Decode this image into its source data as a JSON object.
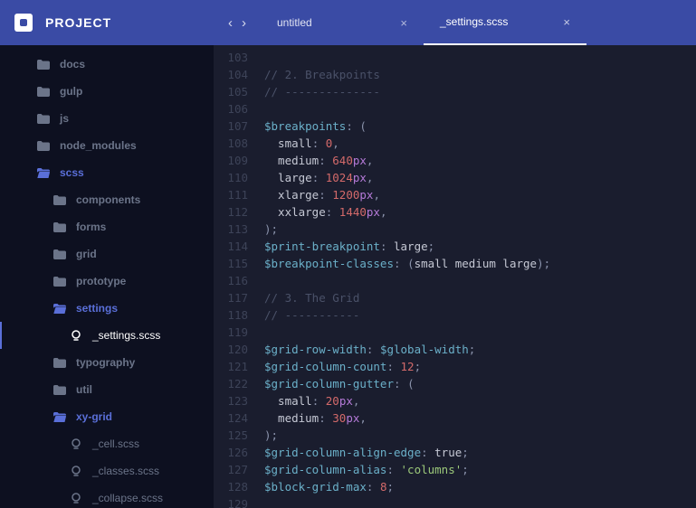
{
  "header": {
    "project_label": "PROJECT"
  },
  "tabs": [
    {
      "label": "untitled",
      "active": false
    },
    {
      "label": "_settings.scss",
      "active": true
    }
  ],
  "tree": [
    {
      "label": "docs",
      "type": "folder",
      "depth": 0,
      "expanded": false
    },
    {
      "label": "gulp",
      "type": "folder",
      "depth": 0,
      "expanded": false
    },
    {
      "label": "js",
      "type": "folder",
      "depth": 0,
      "expanded": false
    },
    {
      "label": "node_modules",
      "type": "folder",
      "depth": 0,
      "expanded": false
    },
    {
      "label": "scss",
      "type": "folder",
      "depth": 0,
      "expanded": true
    },
    {
      "label": "components",
      "type": "folder",
      "depth": 1,
      "expanded": false
    },
    {
      "label": "forms",
      "type": "folder",
      "depth": 1,
      "expanded": false
    },
    {
      "label": "grid",
      "type": "folder",
      "depth": 1,
      "expanded": false
    },
    {
      "label": "prototype",
      "type": "folder",
      "depth": 1,
      "expanded": false
    },
    {
      "label": "settings",
      "type": "folder",
      "depth": 1,
      "expanded": true
    },
    {
      "label": "_settings.scss",
      "type": "file",
      "depth": 2,
      "active": true
    },
    {
      "label": "typography",
      "type": "folder",
      "depth": 1,
      "expanded": false
    },
    {
      "label": "util",
      "type": "folder",
      "depth": 1,
      "expanded": false
    },
    {
      "label": "xy-grid",
      "type": "folder",
      "depth": 1,
      "expanded": true
    },
    {
      "label": "_cell.scss",
      "type": "file",
      "depth": 2,
      "active": false
    },
    {
      "label": "_classes.scss",
      "type": "file",
      "depth": 2,
      "active": false
    },
    {
      "label": "_collapse.scss",
      "type": "file",
      "depth": 2,
      "active": false
    }
  ],
  "editor": {
    "first_line_number": 103,
    "lines": [
      [],
      [
        {
          "t": "// 2. Breakpoints",
          "c": "comment"
        }
      ],
      [
        {
          "t": "// --------------",
          "c": "comment"
        }
      ],
      [],
      [
        {
          "t": "$breakpoints",
          "c": "var"
        },
        {
          "t": ":",
          "c": "punc"
        },
        {
          "t": " ",
          "c": "kw"
        },
        {
          "t": "(",
          "c": "punc"
        }
      ],
      [
        {
          "t": "  small",
          "c": "kw"
        },
        {
          "t": ":",
          "c": "punc"
        },
        {
          "t": " ",
          "c": "kw"
        },
        {
          "t": "0",
          "c": "num"
        },
        {
          "t": ",",
          "c": "punc"
        }
      ],
      [
        {
          "t": "  medium",
          "c": "kw"
        },
        {
          "t": ":",
          "c": "punc"
        },
        {
          "t": " ",
          "c": "kw"
        },
        {
          "t": "640",
          "c": "num"
        },
        {
          "t": "px",
          "c": "unit"
        },
        {
          "t": ",",
          "c": "punc"
        }
      ],
      [
        {
          "t": "  large",
          "c": "kw"
        },
        {
          "t": ":",
          "c": "punc"
        },
        {
          "t": " ",
          "c": "kw"
        },
        {
          "t": "1024",
          "c": "num"
        },
        {
          "t": "px",
          "c": "unit"
        },
        {
          "t": ",",
          "c": "punc"
        }
      ],
      [
        {
          "t": "  xlarge",
          "c": "kw"
        },
        {
          "t": ":",
          "c": "punc"
        },
        {
          "t": " ",
          "c": "kw"
        },
        {
          "t": "1200",
          "c": "num"
        },
        {
          "t": "px",
          "c": "unit"
        },
        {
          "t": ",",
          "c": "punc"
        }
      ],
      [
        {
          "t": "  xxlarge",
          "c": "kw"
        },
        {
          "t": ":",
          "c": "punc"
        },
        {
          "t": " ",
          "c": "kw"
        },
        {
          "t": "1440",
          "c": "num"
        },
        {
          "t": "px",
          "c": "unit"
        },
        {
          "t": ",",
          "c": "punc"
        }
      ],
      [
        {
          "t": ")",
          "c": "punc"
        },
        {
          "t": ";",
          "c": "punc"
        }
      ],
      [
        {
          "t": "$print-breakpoint",
          "c": "var"
        },
        {
          "t": ":",
          "c": "punc"
        },
        {
          "t": " large",
          "c": "val"
        },
        {
          "t": ";",
          "c": "punc"
        }
      ],
      [
        {
          "t": "$breakpoint-classes",
          "c": "var"
        },
        {
          "t": ":",
          "c": "punc"
        },
        {
          "t": " ",
          "c": "kw"
        },
        {
          "t": "(",
          "c": "punc"
        },
        {
          "t": "small medium large",
          "c": "val"
        },
        {
          "t": ")",
          "c": "punc"
        },
        {
          "t": ";",
          "c": "punc"
        }
      ],
      [],
      [
        {
          "t": "// 3. The Grid",
          "c": "comment"
        }
      ],
      [
        {
          "t": "// -----------",
          "c": "comment"
        }
      ],
      [],
      [
        {
          "t": "$grid-row-width",
          "c": "var"
        },
        {
          "t": ":",
          "c": "punc"
        },
        {
          "t": " ",
          "c": "kw"
        },
        {
          "t": "$global-width",
          "c": "var"
        },
        {
          "t": ";",
          "c": "punc"
        }
      ],
      [
        {
          "t": "$grid-column-count",
          "c": "var"
        },
        {
          "t": ":",
          "c": "punc"
        },
        {
          "t": " ",
          "c": "kw"
        },
        {
          "t": "12",
          "c": "num"
        },
        {
          "t": ";",
          "c": "punc"
        }
      ],
      [
        {
          "t": "$grid-column-gutter",
          "c": "var"
        },
        {
          "t": ":",
          "c": "punc"
        },
        {
          "t": " ",
          "c": "kw"
        },
        {
          "t": "(",
          "c": "punc"
        }
      ],
      [
        {
          "t": "  small",
          "c": "kw"
        },
        {
          "t": ":",
          "c": "punc"
        },
        {
          "t": " ",
          "c": "kw"
        },
        {
          "t": "20",
          "c": "num"
        },
        {
          "t": "px",
          "c": "unit"
        },
        {
          "t": ",",
          "c": "punc"
        }
      ],
      [
        {
          "t": "  medium",
          "c": "kw"
        },
        {
          "t": ":",
          "c": "punc"
        },
        {
          "t": " ",
          "c": "kw"
        },
        {
          "t": "30",
          "c": "num"
        },
        {
          "t": "px",
          "c": "unit"
        },
        {
          "t": ",",
          "c": "punc"
        }
      ],
      [
        {
          "t": ")",
          "c": "punc"
        },
        {
          "t": ";",
          "c": "punc"
        }
      ],
      [
        {
          "t": "$grid-column-align-edge",
          "c": "var"
        },
        {
          "t": ":",
          "c": "punc"
        },
        {
          "t": " true",
          "c": "val"
        },
        {
          "t": ";",
          "c": "punc"
        }
      ],
      [
        {
          "t": "$grid-column-alias",
          "c": "var"
        },
        {
          "t": ":",
          "c": "punc"
        },
        {
          "t": " ",
          "c": "kw"
        },
        {
          "t": "'columns'",
          "c": "str"
        },
        {
          "t": ";",
          "c": "punc"
        }
      ],
      [
        {
          "t": "$block-grid-max",
          "c": "var"
        },
        {
          "t": ":",
          "c": "punc"
        },
        {
          "t": " ",
          "c": "kw"
        },
        {
          "t": "8",
          "c": "num"
        },
        {
          "t": ";",
          "c": "punc"
        }
      ],
      []
    ]
  }
}
